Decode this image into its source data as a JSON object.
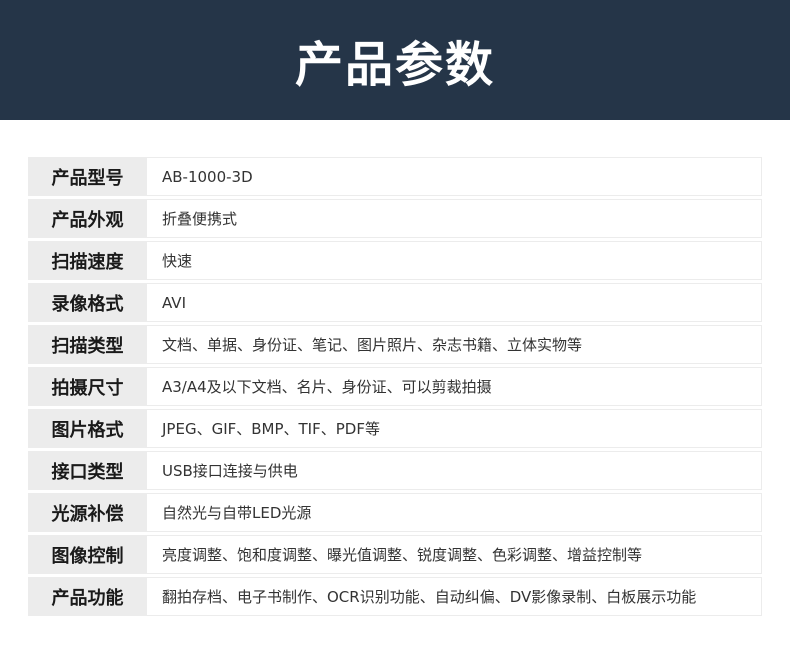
{
  "header": {
    "title": "产品参数"
  },
  "specs": [
    {
      "label": "产品型号",
      "value": "AB-1000-3D"
    },
    {
      "label": "产品外观",
      "value": "折叠便携式"
    },
    {
      "label": "扫描速度",
      "value": "快速"
    },
    {
      "label": "录像格式",
      "value": "AVI"
    },
    {
      "label": "扫描类型",
      "value": "文档、单据、身份证、笔记、图片照片、杂志书籍、立体实物等"
    },
    {
      "label": "拍摄尺寸",
      "value": "A3/A4及以下文档、名片、身份证、可以剪裁拍摄"
    },
    {
      "label": "图片格式",
      "value": "JPEG、GIF、BMP、TIF、PDF等"
    },
    {
      "label": "接口类型",
      "value": "USB接口连接与供电"
    },
    {
      "label": "光源补偿",
      "value": "自然光与自带LED光源"
    },
    {
      "label": "图像控制",
      "value": "亮度调整、饱和度调整、曝光值调整、锐度调整、色彩调整、增益控制等"
    },
    {
      "label": "产品功能",
      "value": "翻拍存档、电子书制作、OCR识别功能、自动纠偏、DV影像录制、白板展示功能"
    }
  ],
  "colors": {
    "header_bg": "#253548",
    "label_bg": "#ececec",
    "border": "#ececec"
  }
}
